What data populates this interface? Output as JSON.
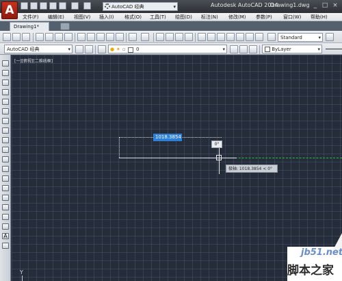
{
  "app_title": "Autodesk AutoCAD 2014",
  "document_title": "Drawing1.dwg",
  "workspace_select": "AutoCAD 经典",
  "window_buttons": [
    "_",
    "□",
    "×"
  ],
  "menu": [
    "文件(F)",
    "编辑(E)",
    "视图(V)",
    "插入(I)",
    "格式(O)",
    "工具(T)",
    "绘图(D)",
    "标注(N)",
    "修改(M)",
    "参数(P)",
    "窗口(W)",
    "帮助(H)"
  ],
  "tabs": [
    "Drawing1*"
  ],
  "toolbar1": {
    "text_style": "Standard"
  },
  "toolbar2": {
    "workspace_combo": "AutoCAD 经典",
    "layer_value": "0",
    "color_combo": "ByLayer"
  },
  "canvas": {
    "viewport_label": "[一][俯视][二维线框]",
    "dynamic_length": "1018.3854",
    "dynamic_angle": "0°",
    "polar_tooltip": "极轴: 1018.3854 < 0°",
    "ucs_label": "Y"
  },
  "watermark": {
    "site": "jb51.net",
    "brand": "脚本之家"
  },
  "colors": {
    "canvas_bg": "#252c3a",
    "tracking_line": "#2fbf3a",
    "dynamic_input_bg": "#2e7fd6",
    "app_logo": "#c8321e"
  },
  "icons": {
    "quick_access": [
      "new-icon",
      "open-icon",
      "save-icon",
      "save-as-icon",
      "print-icon",
      "undo-icon",
      "redo-icon"
    ],
    "left_toolbar": [
      "line-icon",
      "construction-line-icon",
      "polyline-icon",
      "polygon-icon",
      "rectangle-icon",
      "arc-icon",
      "circle-icon",
      "revision-cloud-icon",
      "spline-icon",
      "ellipse-icon",
      "ellipse-arc-icon",
      "insert-block-icon",
      "make-block-icon",
      "point-icon",
      "hatch-icon",
      "gradient-icon",
      "region-icon",
      "table-icon",
      "multiline-text-icon",
      "add-selected-icon"
    ]
  }
}
